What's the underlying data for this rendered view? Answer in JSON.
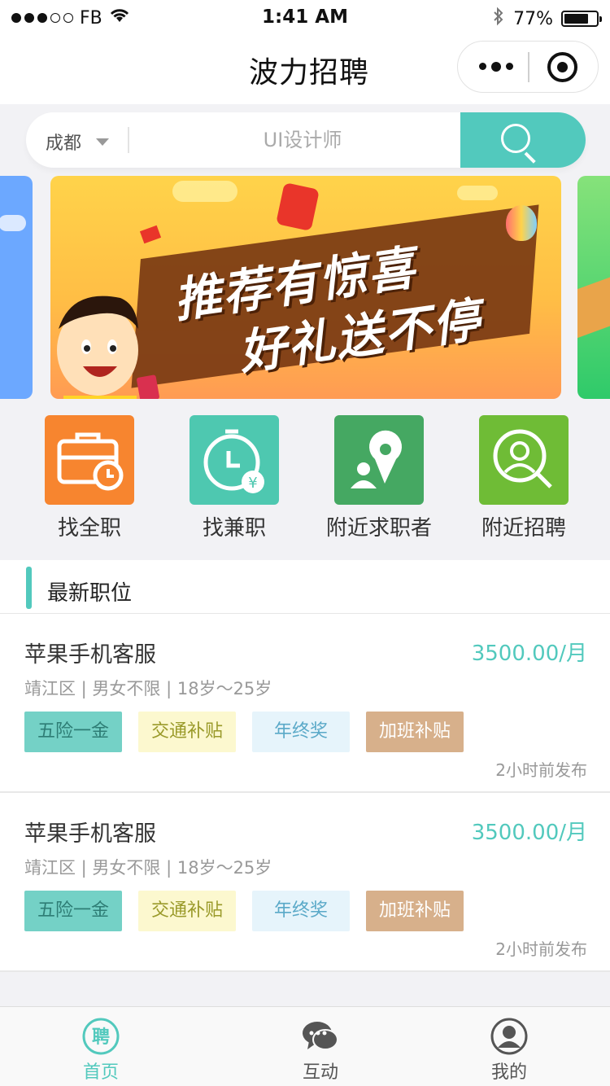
{
  "status_bar": {
    "carrier": "FB",
    "time": "1:41 AM",
    "battery_percent": "77%",
    "battery_level": 0.77
  },
  "nav": {
    "title": "波力招聘"
  },
  "search": {
    "city": "成都",
    "placeholder": "UI设计师"
  },
  "banner": {
    "line1": "推荐有惊喜",
    "line2": "好礼送不停"
  },
  "categories": [
    {
      "label": "找全职",
      "icon": "briefcase-clock-icon",
      "color": "#f7852f"
    },
    {
      "label": "找兼职",
      "icon": "stopwatch-yen-icon",
      "color": "#4ec8b0"
    },
    {
      "label": "附近求职者",
      "icon": "person-location-pin-icon",
      "color": "#45a862"
    },
    {
      "label": "附近招聘",
      "icon": "person-search-icon",
      "color": "#6fbc36"
    }
  ],
  "section": {
    "title": "最新职位"
  },
  "jobs": [
    {
      "title": "苹果手机客服",
      "salary": "3500.00/月",
      "meta": "靖江区 | 男女不限 | 18岁～25岁",
      "tags": [
        "五险一金",
        "交通补贴",
        "年终奖",
        "加班补贴"
      ],
      "posted": "2小时前发布"
    },
    {
      "title": "苹果手机客服",
      "salary": "3500.00/月",
      "meta": "靖江区 | 男女不限 | 18岁～25岁",
      "tags": [
        "五险一金",
        "交通补贴",
        "年终奖",
        "加班补贴"
      ],
      "posted": "2小时前发布"
    }
  ],
  "tabs": [
    {
      "label": "首页",
      "icon": "hire-badge-icon",
      "active": true
    },
    {
      "label": "互动",
      "icon": "chat-bubbles-icon",
      "active": false
    },
    {
      "label": "我的",
      "icon": "user-profile-icon",
      "active": false
    }
  ],
  "colors": {
    "accent": "#52c9bd",
    "inactive_tab": "#555555"
  }
}
